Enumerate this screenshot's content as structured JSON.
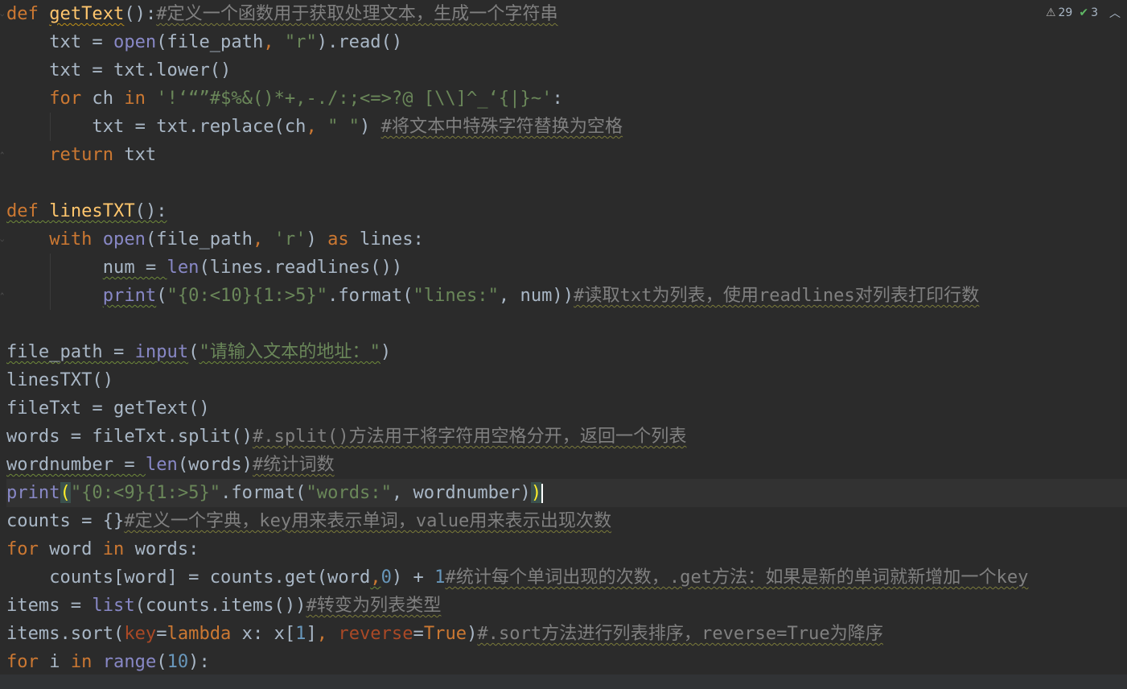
{
  "status": {
    "warnings_count": "29",
    "ok_count": "3",
    "warning_icon": "warning-triangle-icon",
    "ok_icon": "double-check-icon",
    "collapse_icon": "chevron-up-icon"
  },
  "colors": {
    "background": "#2b2b2b",
    "keyword": "#cc7832",
    "function": "#ffc66d",
    "builtin": "#8888c6",
    "string": "#6a8759",
    "number": "#6897bb",
    "comment": "#808080",
    "plain": "#a9b7c6",
    "param": "#aa4926"
  },
  "code": {
    "l1": {
      "kw": "def",
      "fn": "getText",
      "p": "():",
      "cm": "#定义一个函数用于获取处理文本，生成一个字符串"
    },
    "l2": {
      "a": "txt = ",
      "bi": "open",
      "b": "(file_path",
      "c": ", ",
      "str": "\"r\"",
      "d": ").read()"
    },
    "l3": {
      "a": "txt = txt.lower()"
    },
    "l4": {
      "kw1": "for",
      "a": " ch ",
      "kw2": "in",
      "b": " ",
      "str": "'!‘“”#$%&()*+,-./:;<=>?@ [\\\\]^_‘{|}~'",
      "c": ":"
    },
    "l5": {
      "a": "txt = txt.replace(ch",
      "b": ", ",
      "str": "\" \"",
      "c": ") ",
      "cm": "#将文本中特殊字符替换为空格"
    },
    "l6": {
      "kw": "return",
      "a": " txt"
    },
    "l7": {
      "a": ""
    },
    "l8": {
      "kw": "def",
      "fn": "linesTXT",
      "p": "():"
    },
    "l9": {
      "kw": "with",
      "a": " ",
      "bi": "open",
      "b": "(file_path",
      "c": ", ",
      "str": "'r'",
      "d": ") ",
      "kw2": "as",
      "e": " lines:"
    },
    "l10": {
      "a": "num = ",
      "bi": "len",
      "b": "(lines.readlines())"
    },
    "l11": {
      "bi": "print",
      "a": "(",
      "str1": "\"{0:<10}{1:>5}\"",
      "b": ".format(",
      "str2": "\"lines:\"",
      "c": ", num))",
      "cm": "#读取txt为列表，使用readlines对列表打印行数"
    },
    "l12": {
      "a": ""
    },
    "l13": {
      "a": "file_path = ",
      "bi": "input",
      "b": "(",
      "str": "\"请输入文本的地址：\"",
      "c": ")"
    },
    "l14": {
      "a": "linesTXT()"
    },
    "l15": {
      "a": "fileTxt = getText()"
    },
    "l16": {
      "a": "words = fileTxt.split()",
      "cm": "#.split()方法用于将字符用空格分开，返回一个列表"
    },
    "l17": {
      "a": "wordnumber = ",
      "bi": "len",
      "b": "(words)",
      "cm": "#统计词数"
    },
    "l18": {
      "bi": "print",
      "a": "(",
      "str1": "\"{0:<9}{1:>5}\"",
      "b": ".format(",
      "str2": "\"words:\"",
      "c": ", wordnumber)",
      "d": ")"
    },
    "l19": {
      "a": "counts = {}",
      "cm": "#定义一个字典，key用来表示单词，value用来表示出现次数"
    },
    "l20": {
      "kw1": "for",
      "a": " word ",
      "kw2": "in",
      "b": " words:"
    },
    "l21": {
      "a": "counts[word] = counts.get(word",
      "b": ",",
      "num1": "0",
      "c": ") + ",
      "num2": "1",
      "cm": "#统计每个单词出现的次数，.get方法：如果是新的单词就新增加一个key"
    },
    "l22": {
      "a": "items = ",
      "bi": "list",
      "b": "(counts.items())",
      "cm": "#转变为列表类型"
    },
    "l23": {
      "a": "items.sort(",
      "pm1": "key",
      "b": "=",
      "kw": "lambda",
      "c": " x: x[",
      "num": "1",
      "d": "]",
      "e": ", ",
      "pm2": "reverse",
      "f": "=",
      "kw2": "True",
      "g": ")",
      "cm": "#.sort方法进行列表排序，reverse=True为降序"
    },
    "l24": {
      "kw1": "for",
      "a": " i ",
      "kw2": "in",
      "b": " ",
      "bi": "range",
      "c": "(",
      "num": "10",
      "d": "):"
    }
  }
}
